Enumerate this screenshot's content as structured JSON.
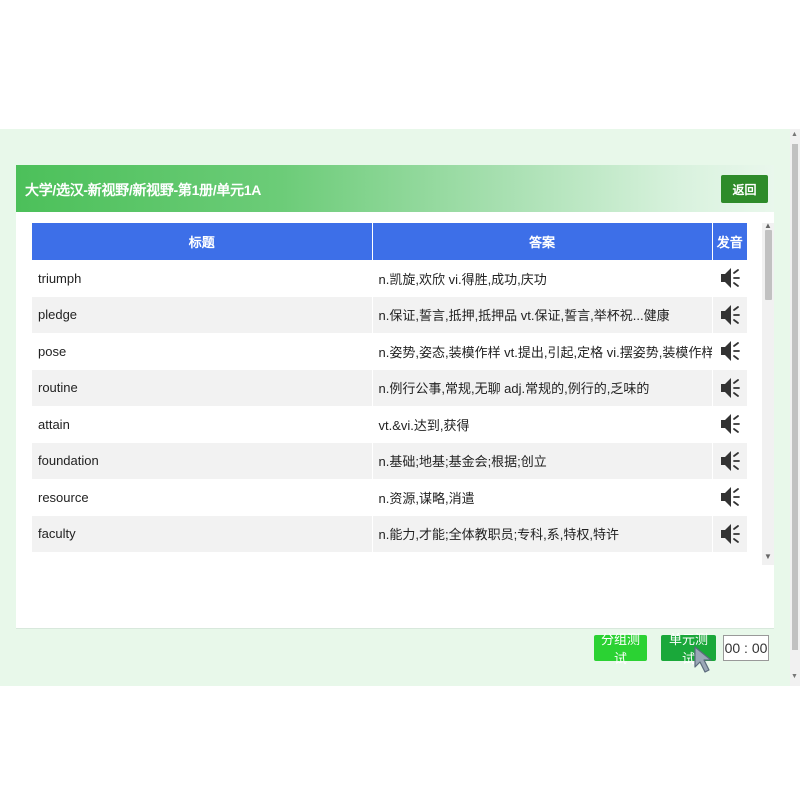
{
  "header": {
    "breadcrumb": "大学/选汉-新视野/新视野-第1册/单元1A",
    "back_label": "返回"
  },
  "table": {
    "columns": [
      "标题",
      "答案",
      "发音"
    ],
    "rows": [
      {
        "word": "triumph",
        "meaning": "n.凯旋,欢欣 vi.得胜,成功,庆功"
      },
      {
        "word": "pledge",
        "meaning": "n.保证,誓言,抵押,抵押品 vt.保证,誓言,举杯祝...健康"
      },
      {
        "word": "pose",
        "meaning": "n.姿势,姿态,装模作样 vt.提出,引起,定格 vi.摆姿势,装模作样"
      },
      {
        "word": "routine",
        "meaning": "n.例行公事,常规,无聊 adj.常规的,例行的,乏味的"
      },
      {
        "word": "attain",
        "meaning": "vt.&vi.达到,获得"
      },
      {
        "word": "foundation",
        "meaning": "n.基础;地基;基金会;根据;创立"
      },
      {
        "word": "resource",
        "meaning": "n.资源,谋略,消遣"
      },
      {
        "word": "faculty",
        "meaning": "n.能力,才能;全体教职员;专科,系,特权,特许"
      }
    ],
    "speaker_icon": "speaker-icon"
  },
  "footer": {
    "group_test_label": "分组测试",
    "unit_test_label": "单元测试",
    "timer": "00 : 00"
  },
  "colors": {
    "header_green": "#4cc05a",
    "table_header_blue": "#3d6fe8",
    "back_button": "#2e8b2a",
    "group_test_button": "#2bd233",
    "unit_test_button": "#1aa83a",
    "page_bg": "#e8f8ea"
  }
}
